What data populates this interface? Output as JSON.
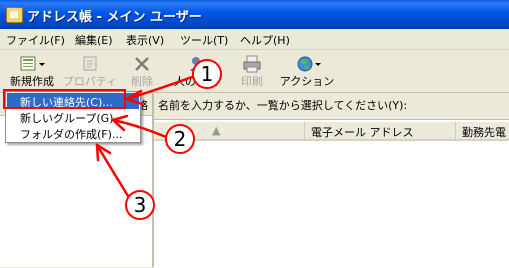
{
  "window": {
    "title": "アドレス帳 - メイン ユーザー"
  },
  "menu": [
    "ファイル(F)",
    "編集(E)",
    "表示(V)",
    "ツール(T)",
    "ヘルプ(H)"
  ],
  "toolbar": {
    "new": "新規作成",
    "properties": "プロパティ",
    "delete": "削除",
    "find_people": "人の検索",
    "print": "印刷",
    "action": "アクション"
  },
  "left_pane": {
    "header": "連絡"
  },
  "right_pane": {
    "prompt": "名前を入力するか、一覧から選択してください(Y):",
    "search_value": "",
    "columns": [
      "",
      "電子メール アドレス",
      "勤務先電"
    ]
  },
  "dropdown": {
    "items": [
      "新しい連絡先(C)...",
      "新しいグループ(G)...",
      "フォルダの作成(F)..."
    ]
  },
  "annotations": {
    "numbers": [
      "1",
      "2",
      "3"
    ],
    "color": "#FF0000"
  }
}
